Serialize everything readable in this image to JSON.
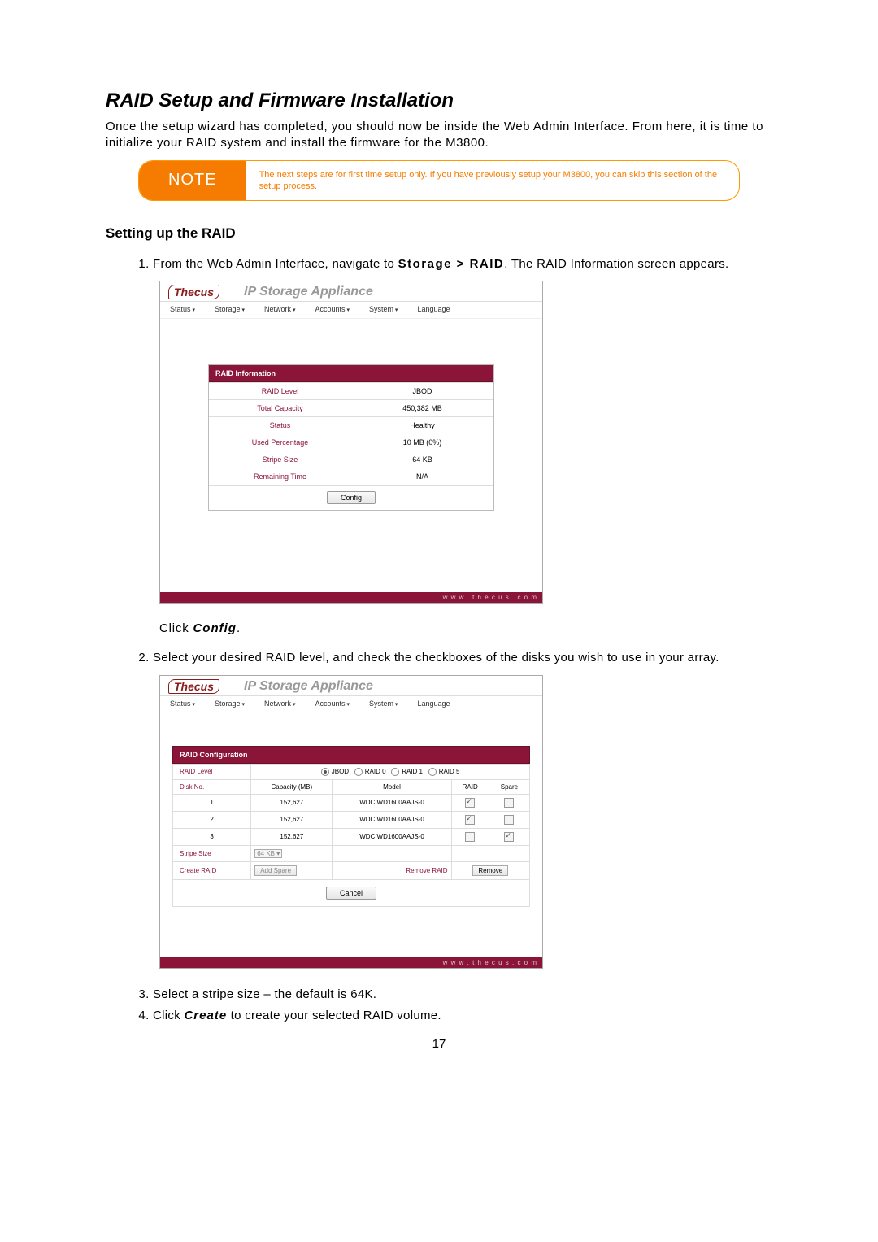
{
  "title": "RAID Setup and Firmware Installation",
  "intro": "Once the setup wizard has completed, you should now be inside the Web Admin Interface. From here, it is time to initialize your RAID system and install the firmware for the M3800.",
  "note": {
    "label": "NOTE",
    "text": "The next steps are for first time setup only. If you have previously setup your M3800, you can skip this section of the setup process."
  },
  "sub_title": "Setting up the RAID",
  "steps": {
    "s1a": "From the Web Admin Interface, navigate to ",
    "s1b": "Storage > RAID",
    "s1c": ". The RAID Information screen appears.",
    "s_click": "Click ",
    "s_click_i": "Config",
    "s_click_dot": ".",
    "s2": "Select your desired RAID level, and check the checkboxes of the disks you wish to use in your array.",
    "s3": "Select a stripe size – the default is 64K.",
    "s4a": "Click ",
    "s4b": "Create",
    "s4c": " to create your selected RAID volume."
  },
  "ss": {
    "logo": "Thecus",
    "app_title": "IP Storage Appliance",
    "menu": [
      "Status",
      "Storage",
      "Network",
      "Accounts",
      "System",
      "Language"
    ],
    "footer": "w w w . t h e c u s . c o m"
  },
  "raid_info": {
    "header": "RAID Information",
    "rows": [
      {
        "label": "RAID Level",
        "value": "JBOD"
      },
      {
        "label": "Total Capacity",
        "value": "450,382 MB"
      },
      {
        "label": "Status",
        "value": "Healthy"
      },
      {
        "label": "Used Percentage",
        "value": "10 MB (0%)"
      },
      {
        "label": "Stripe Size",
        "value": "64 KB"
      },
      {
        "label": "Remaining Time",
        "value": "N/A"
      }
    ],
    "config_btn": "Config"
  },
  "raid_cfg": {
    "header": "RAID Configuration",
    "level_label": "RAID Level",
    "levels": [
      "JBOD",
      "RAID 0",
      "RAID 1",
      "RAID 5"
    ],
    "cols": [
      "Disk No.",
      "Capacity (MB)",
      "Model",
      "RAID",
      "Spare"
    ],
    "disks": [
      {
        "no": "1",
        "cap": "152,627",
        "model": "WDC WD1600AAJS-0",
        "raid": true,
        "spare": false
      },
      {
        "no": "2",
        "cap": "152,627",
        "model": "WDC WD1600AAJS-0",
        "raid": true,
        "spare": false
      },
      {
        "no": "3",
        "cap": "152,627",
        "model": "WDC WD1600AAJS-0",
        "raid": false,
        "spare": true
      }
    ],
    "stripe_label": "Stripe Size",
    "stripe_value": "64 KB",
    "create_label": "Create RAID",
    "add_spare_btn": "Add Spare",
    "remove_raid_label": "Remove RAID",
    "remove_btn": "Remove",
    "cancel_btn": "Cancel"
  },
  "page_number": "17"
}
